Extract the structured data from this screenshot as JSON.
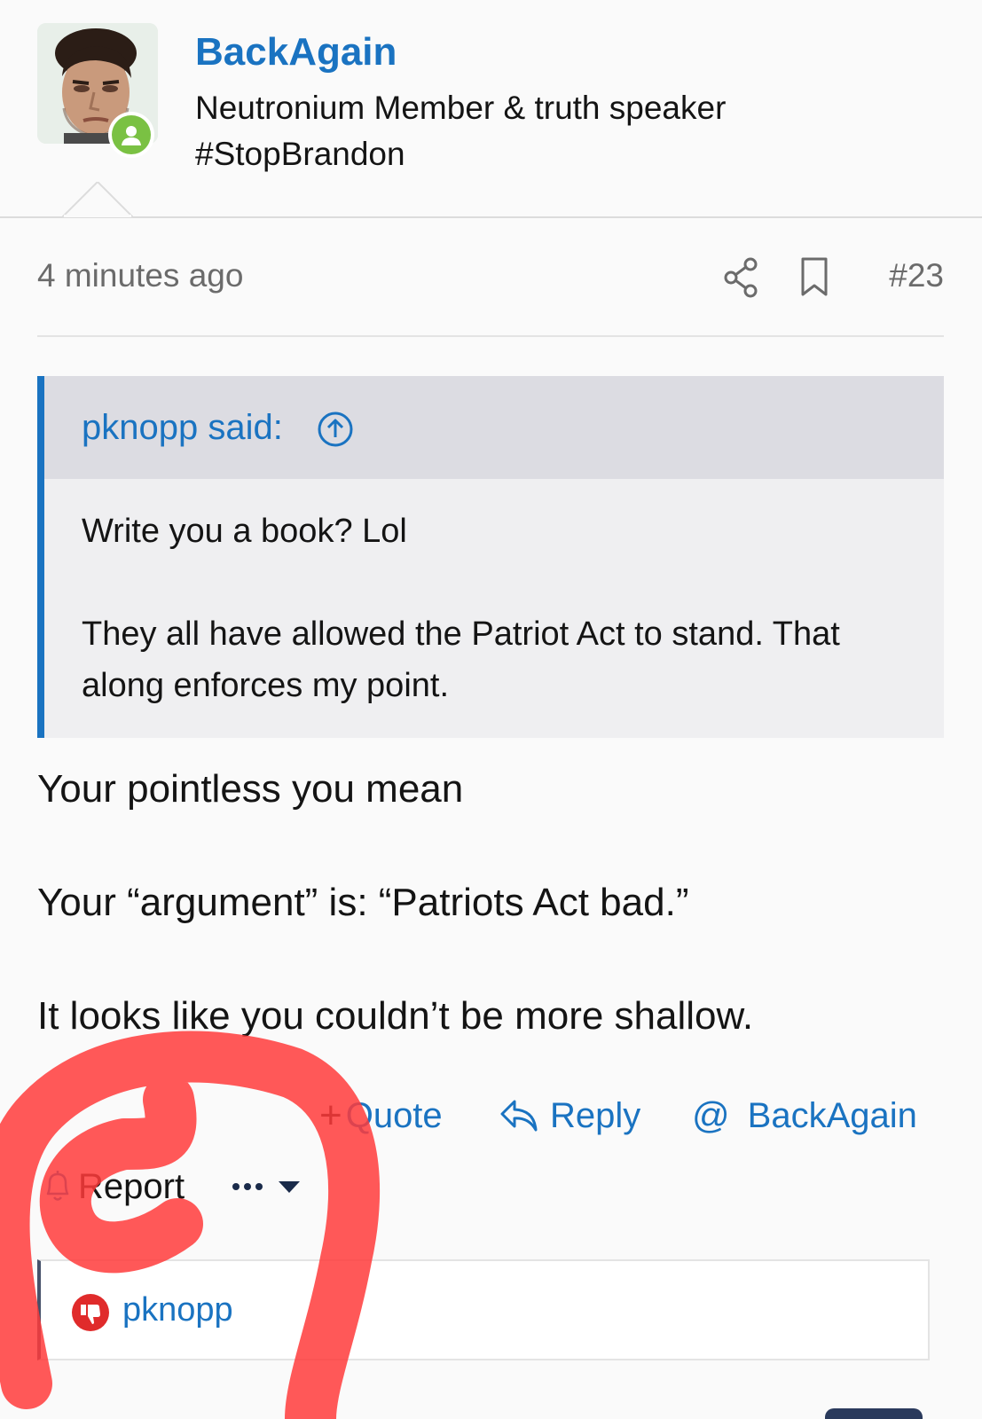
{
  "author": {
    "username": "BackAgain",
    "title_line1": "Neutronium Member & truth speaker",
    "title_line2": "#StopBrandon"
  },
  "post": {
    "timestamp": "4 minutes ago",
    "number": "#23"
  },
  "quote": {
    "author": "pknopp said:",
    "lines": [
      "Write you a book? Lol",
      "They all have allowed the Patriot Act to stand. That along enforces my point."
    ]
  },
  "message": {
    "paragraphs": [
      "Your pointless you mean",
      "Your “argument” is: “Patriots Act bad.”",
      "It looks like you couldn’t be more shallow."
    ]
  },
  "actions": {
    "quote_label": "Quote",
    "quote_prefix": "+",
    "reply_label": "Reply",
    "mention_label": "BackAgain",
    "report_label": "Report"
  },
  "reactions": {
    "user": "pknopp",
    "type_icon": "thumbs-down-icon"
  },
  "colors": {
    "link": "#1a73c1",
    "online": "#7ac143",
    "dislike": "#e02b2b",
    "annotation": "#ff3b3b"
  }
}
